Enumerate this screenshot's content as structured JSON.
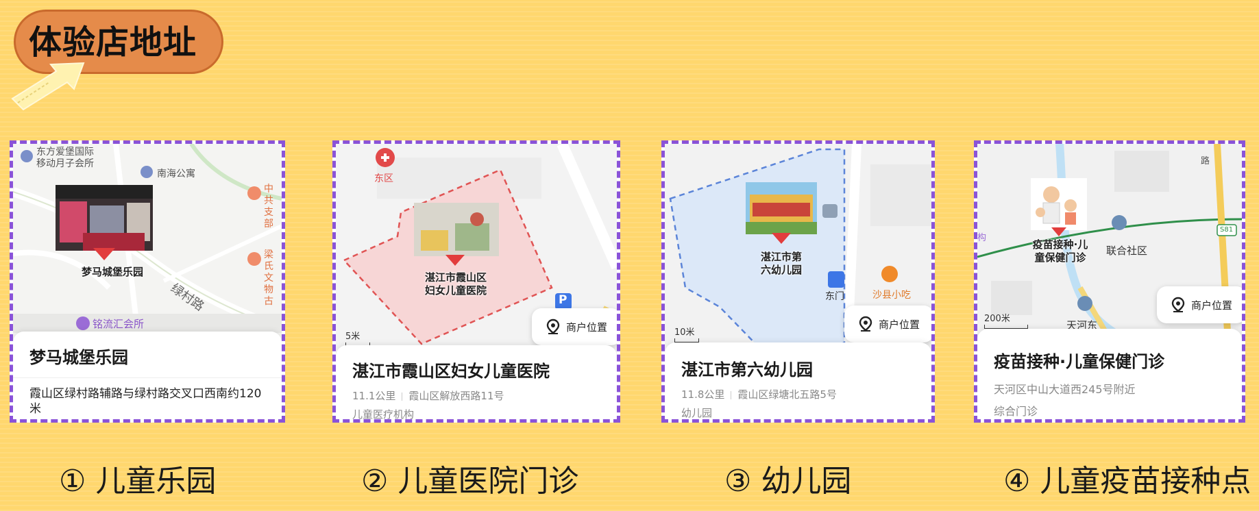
{
  "banner": {
    "title": "体验店地址"
  },
  "colors": {
    "background": "#FFD76E",
    "banner": "#E58B4A",
    "card_border": "#8A53D8",
    "pin": "#E23D3D"
  },
  "cards": [
    {
      "map_labels": {
        "poi1": "东方爱堡国际",
        "poi1b": "移动月子会所",
        "poi2": "南海公寓",
        "poi3": "中共",
        "poi3b": "支部",
        "poi4": "梁氏",
        "poi4b": "文物古",
        "road": "绿村路",
        "poi5": "铭流汇会所"
      },
      "pin_label": "梦马城堡乐园",
      "title": "梦马城堡乐园",
      "address": "霞山区绿村路辅路与绿村路交叉口西南约120米"
    },
    {
      "map_labels": {
        "district": "东区",
        "parking": "P",
        "scale": "5米"
      },
      "pin_label_line1": "湛江市霞山区",
      "pin_label_line2": "妇女儿童医院",
      "location_button": "商户位置",
      "title": "湛江市霞山区妇女儿童医院",
      "distance": "11.1公里",
      "address": "霞山区解放西路11号",
      "category": "儿童医疗机构"
    },
    {
      "map_labels": {
        "gate": "东门",
        "food": "沙县小吃",
        "scale": "10米"
      },
      "pin_label_line1": "湛江市第",
      "pin_label_line2": "六幼儿园",
      "location_button": "商户位置",
      "title": "湛江市第六幼儿园",
      "distance": "11.8公里",
      "address": "霞山区绿塘北五路5号",
      "category": "幼儿园"
    },
    {
      "map_labels": {
        "community": "联合社区",
        "tianhe": "天河东",
        "road": "路",
        "metro": "S81",
        "scale": "200米",
        "edge": "构"
      },
      "pin_label_line1": "疫苗接种·儿",
      "pin_label_line2": "童保健门诊",
      "location_button": "商户位置",
      "title": "疫苗接种·儿童保健门诊",
      "address": "天河区中山大道西245号附近",
      "category": "综合门诊"
    }
  ],
  "captions": [
    "① 儿童乐园",
    "② 儿童医院门诊",
    "③ 幼儿园",
    "④ 儿童疫苗接种点"
  ]
}
